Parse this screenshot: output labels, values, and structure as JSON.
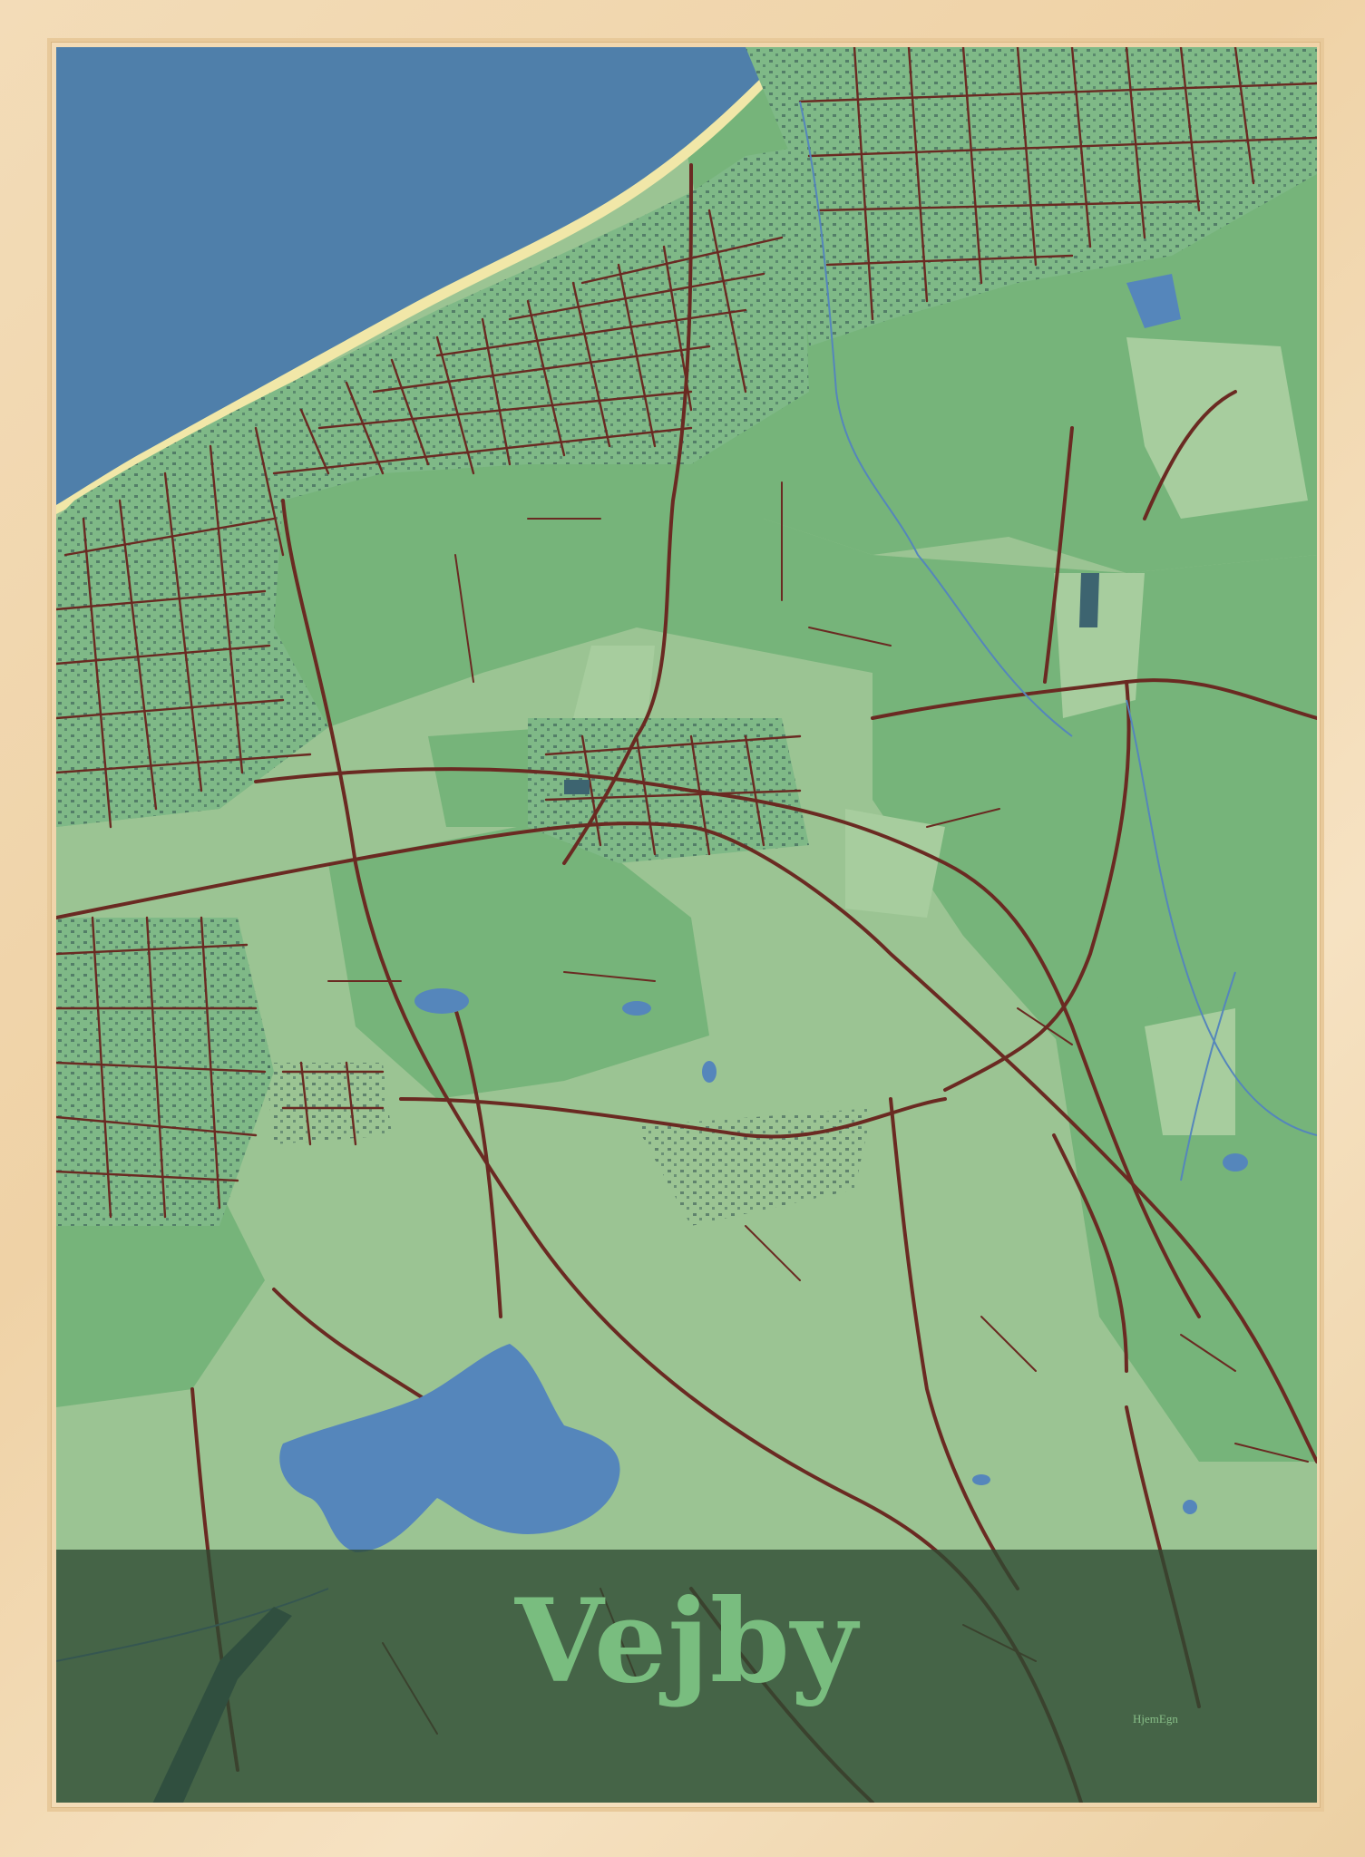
{
  "poster": {
    "place_name": "Vejby",
    "brand": "HjemEgn"
  },
  "colors": {
    "frame": "#efd5ab",
    "sea": "#4f7faa",
    "beach": "#f1e7a8",
    "land_light": "#9bc493",
    "land_mid": "#76b47a",
    "land_dark": "#6aa56e",
    "roads": "#6a2a22",
    "lake": "#5586bb",
    "title_band": "#2d4932",
    "title_text": "#79bd7f"
  },
  "map": {
    "features": [
      "sea",
      "coastline",
      "residential-street-grid",
      "roads",
      "forest-areas",
      "fields",
      "lakes",
      "streams"
    ]
  }
}
